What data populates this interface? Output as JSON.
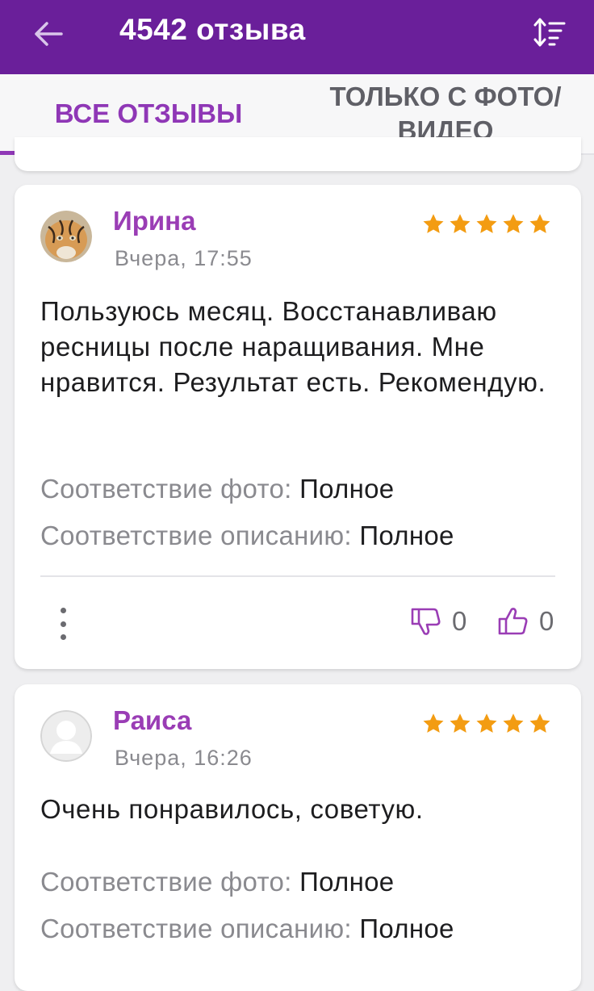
{
  "header": {
    "title": "4542 отзыва"
  },
  "tabs": [
    {
      "label": "ВСЕ ОТЗЫВЫ",
      "active": true
    },
    {
      "label": "ТОЛЬКО С ФОТО/ ВИДЕО",
      "active": false
    }
  ],
  "reviews": [
    {
      "author": "Ирина",
      "date": "Вчера, 17:55",
      "rating": 5,
      "text": "Пользуюсь месяц. Восстанавливаю ресницы после наращивания. Мне нравится. Результат есть. Рекомендую.",
      "photo_match_label": "Соответствие фото:",
      "photo_match_value": "Полное",
      "desc_match_label": "Соответствие описанию:",
      "desc_match_value": "Полное",
      "dislikes": "0",
      "likes": "0"
    },
    {
      "author": "Раиса",
      "date": "Вчера, 16:26",
      "rating": 5,
      "text": "Очень понравилось, советую.",
      "photo_match_label": "Соответствие фото:",
      "photo_match_value": "Полное",
      "desc_match_label": "Соответствие описанию:",
      "desc_match_value": "Полное"
    }
  ],
  "colors": {
    "brand": "#6a1f9a",
    "accent": "#8f37b6",
    "author": "#9a3db5",
    "star": "#f39c12"
  }
}
